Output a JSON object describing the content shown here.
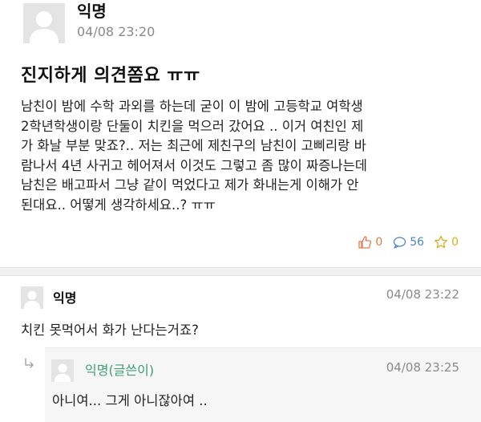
{
  "post": {
    "author": "익명",
    "time": "04/08 23:20",
    "title": "진지하게 의견쫌요 ㅠㅠ",
    "body_lines": [
      "남친이 밤에 수학 과외를 하는데 굳이 이 밤에 고등학교 여학생",
      "2학년학생이랑 단둘이 치킨을 먹으러 갔어요 .. 이거 여친인 제",
      "가 화날 부분 맞죠?.. 저는 최근에 제친구의 남친이 고삐리랑 바",
      "람나서 4년 사귀고 헤어져서 이것도 그렇고 좀 많이 짜증나는데",
      "남친은 배고파서 그냥 같이 먹었다고 제가 화내는게 이해가 안",
      "된대요.. 어떻게 생각하세요..? ㅠㅠ"
    ],
    "likes": "0",
    "comments": "56",
    "scraps": "0"
  },
  "comment": {
    "author": "익명",
    "time": "04/08 23:22",
    "text": "치킨 못먹어서 화가 난다는거죠?"
  },
  "reply": {
    "author": "익명(글쓴이)",
    "time": "04/08 23:25",
    "text": "아니여... 그게 아니잖아여 .."
  },
  "colors": {
    "like": "#e07a4a",
    "comment": "#4a86c8",
    "scrap": "#d8b020",
    "writer_author": "#3d9e73"
  },
  "icons": [
    "anonymous-avatar-icon",
    "thumbs-up-icon",
    "speech-bubble-icon",
    "star-icon",
    "reply-arrow-icon"
  ]
}
